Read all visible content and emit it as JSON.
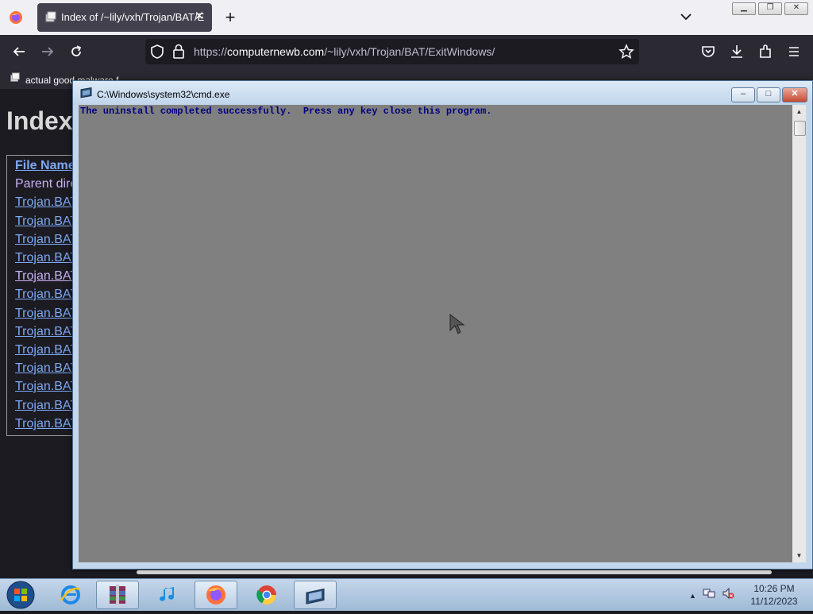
{
  "browser": {
    "tab_title": "Index of /~lily/vxh/Trojan/BAT/ExitWindows/",
    "url_prefix": "https://",
    "url_host": "computernewb.com",
    "url_path": "/~lily/vxh/Trojan/BAT/ExitWindows/",
    "bookmark_label": "actual good malware f",
    "icons": [
      "firefox-menu-icon",
      "new-tab-icon",
      "back-icon",
      "forward-icon",
      "reload-icon",
      "shield-icon",
      "lock-icon",
      "star-icon",
      "pocket-icon",
      "download-icon",
      "extensions-icon",
      "menu-icon"
    ]
  },
  "page": {
    "heading": "Index",
    "column_header": "File Name",
    "rows": [
      "Parent dire",
      "Trojan.BAT",
      "Trojan.BAT",
      "Trojan.BAT",
      "Trojan.BAT",
      "Trojan.BAT",
      "Trojan.BAT",
      "Trojan.BAT",
      "Trojan.BAT",
      "Trojan.BAT",
      "Trojan.BAT",
      "Trojan.BAT",
      "Trojan.BAT",
      "Trojan.BAT"
    ]
  },
  "cmd": {
    "title": "C:\\Windows\\system32\\cmd.exe",
    "output": "The uninstall completed successfully.  Press any key close this program.",
    "minimize": "–",
    "maximize": "□",
    "close": "✕"
  },
  "taskbar": {
    "time": "10:26 PM",
    "date": "11/12/2023",
    "apps": [
      "internet-explorer-icon",
      "winrar-icon",
      "itunes-icon",
      "firefox-icon",
      "chrome-icon",
      "cmd-icon"
    ]
  },
  "colors": {
    "cmd_background": "#808080",
    "cmd_text": "#000080",
    "link": "#7ea9f5"
  }
}
